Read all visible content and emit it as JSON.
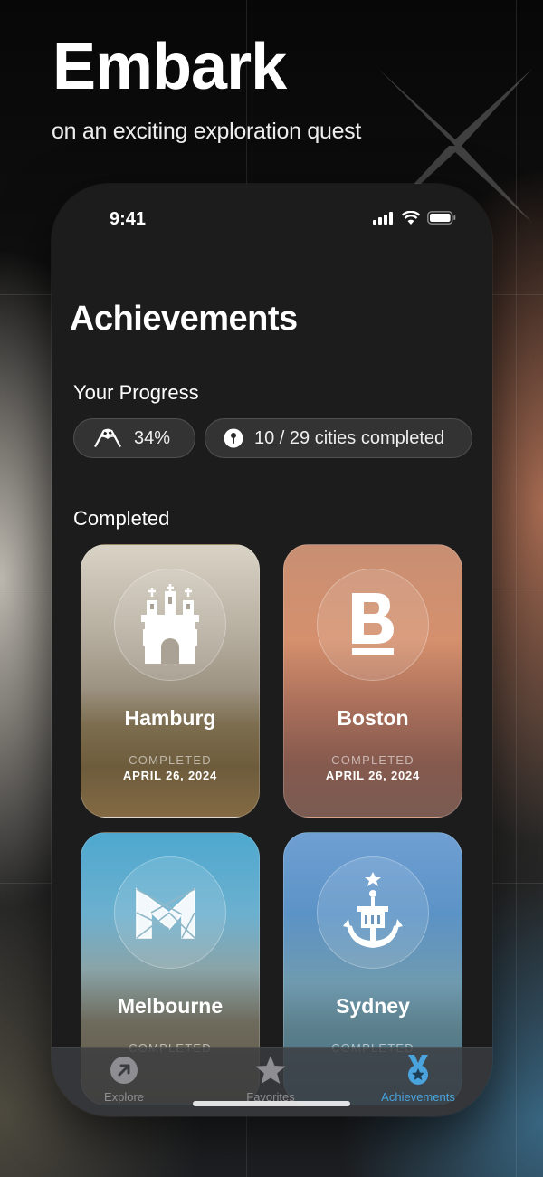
{
  "hero": {
    "title": "Embark",
    "subtitle": "on an exciting exploration quest"
  },
  "status_bar": {
    "time": "9:41",
    "icons": [
      "cellular-signal-icon",
      "wifi-icon",
      "battery-icon"
    ]
  },
  "screen": {
    "title": "Achievements",
    "progress": {
      "heading": "Your Progress",
      "percent_label": "34%",
      "cities_label": "10 / 29 cities completed"
    },
    "completed": {
      "heading": "Completed",
      "cards": [
        {
          "city": "Hamburg",
          "status": "COMPLETED",
          "date": "APRIL 26, 2024",
          "emblem": "hamburg-castle-icon"
        },
        {
          "city": "Boston",
          "status": "COMPLETED",
          "date": "APRIL 26, 2024",
          "emblem": "boston-b-icon"
        },
        {
          "city": "Melbourne",
          "status": "COMPLETED",
          "date": "",
          "emblem": "melbourne-m-icon"
        },
        {
          "city": "Sydney",
          "status": "COMPLETED",
          "date": "",
          "emblem": "sydney-anchor-icon"
        }
      ]
    }
  },
  "tabbar": {
    "tabs": [
      {
        "label": "Explore",
        "icon": "compass-arrow-icon",
        "active": false
      },
      {
        "label": "Favorites",
        "icon": "star-icon",
        "active": false
      },
      {
        "label": "Achievements",
        "icon": "medal-icon",
        "active": true
      }
    ]
  },
  "colors": {
    "accent": "#4aa3dd",
    "phone_bg": "#1c1c1d",
    "inactive_tab": "#8e8e92"
  }
}
